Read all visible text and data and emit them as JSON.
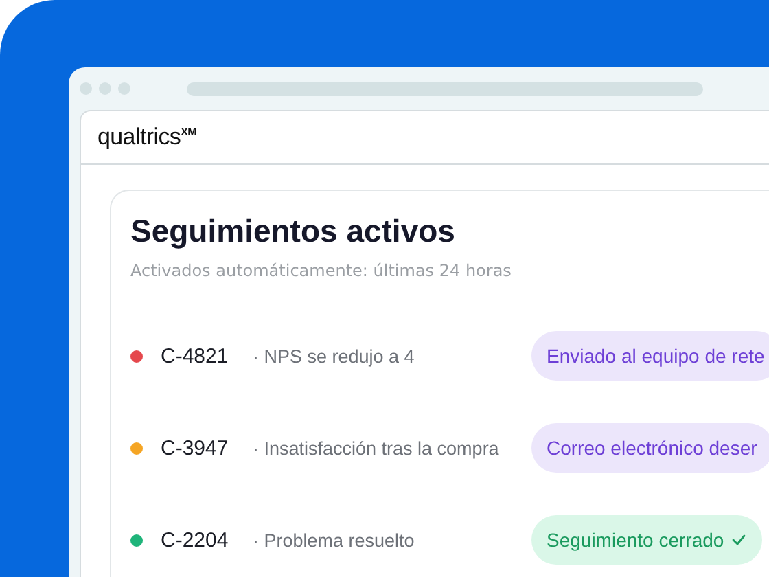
{
  "window": {
    "logo": "qualtrics$^{XM}$"
  },
  "panel": {
    "title": "Seguimientos activos",
    "subtitle": "Activados automáticamente: últimas 24 horas",
    "rows": [
      {
        "id": "C-4821",
        "reason": "· NPS se redujo a 4",
        "color": "#e5484d",
        "status": "Enviado al equipo de rete",
        "kind": "pending"
      },
      {
        "id": "C-3947",
        "reason": "· Insatisfacción tras la compra",
        "color": "#f5a524",
        "status": "Correo electrónico deser",
        "kind": "pending"
      },
      {
        "id": "C-2204",
        "reason": "· Problema resuelto",
        "color": "#1fb47a",
        "status": "Seguimiento cerrado",
        "kind": "done"
      }
    ]
  }
}
